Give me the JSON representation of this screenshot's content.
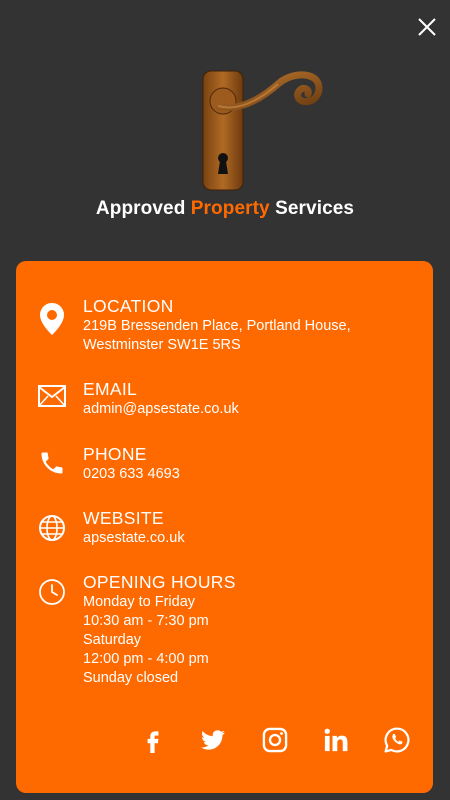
{
  "brand": {
    "part1": "Approved ",
    "part2": "Property",
    "part3": " Services"
  },
  "contact": {
    "location": {
      "title": "LOCATION",
      "line1": "219B Bressenden Place, Portland House,",
      "line2": "Westminster SW1E 5RS"
    },
    "email": {
      "title": "EMAIL",
      "value": "admin@apsestate.co.uk"
    },
    "phone": {
      "title": "PHONE",
      "value": "0203 633 4693"
    },
    "website": {
      "title": "WEBSITE",
      "value": "apsestate.co.uk"
    },
    "hours": {
      "title": "OPENING HOURS",
      "lines": [
        "Monday to Friday",
        "10:30 am - 7:30 pm",
        "Saturday",
        "12:00 pm - 4:00 pm",
        "Sunday closed"
      ]
    }
  },
  "socials": [
    "facebook-icon",
    "twitter-icon",
    "instagram-icon",
    "linkedin-icon",
    "whatsapp-icon"
  ],
  "colors": {
    "background": "#333333",
    "accent": "#ff6a00",
    "text": "#ffffff"
  }
}
